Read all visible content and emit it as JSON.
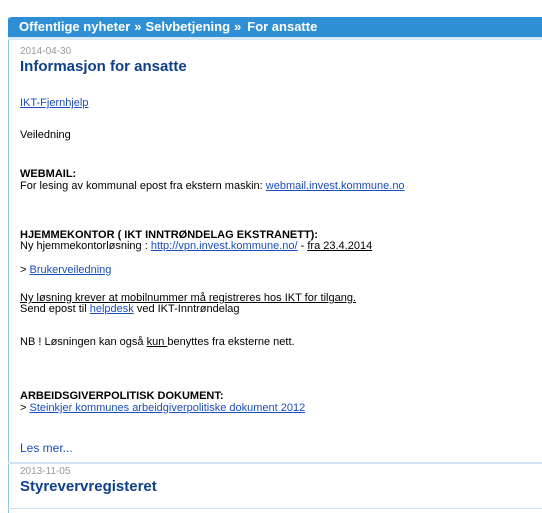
{
  "breadcrumb": {
    "items": [
      "Offentlige nyheter",
      "Selvbetjening",
      "For ansatte"
    ],
    "separator": "»"
  },
  "article1": {
    "date": "2014-04-30",
    "title": "Informasjon for ansatte",
    "ikt_link": "IKT-Fjernhjelp",
    "veiledning": "Veiledning",
    "webmail_heading": "WEBMAIL:",
    "webmail_text": "For lesing av kommunal epost fra ekstern maskin: ",
    "webmail_link": "webmail.invest.kommune.no",
    "hjemmekontor_heading": "HJEMMEKONTOR ( IKT INNTRØNDELAG EKSTRANETT):",
    "hjemmekontor_text": "Ny hjemmekontorløsning : ",
    "vpn_link": "http://vpn.invest.kommune.no/",
    "vpn_dash": " - ",
    "vpn_date": "fra 23.4.2014",
    "bruker_prefix": "> ",
    "brukerveiledning_link": "Brukerveiledning",
    "mobil_text": "Ny løsning krever at mobilnummer må registreres hos IKT for tilgang.",
    "send_prefix": "Send epost til ",
    "helpdesk_link": "helpdesk",
    "send_suffix": " ved IKT-Inntrøndelag",
    "nb_prefix": "NB ! Løsningen kan også ",
    "nb_kun": "kun ",
    "nb_suffix": "benyttes fra eksterne nett.",
    "arbeid_heading": "ARBEIDSGIVERPOLITISK DOKUMENT:",
    "arbeid_prefix": "> ",
    "arbeid_link": "Steinkjer kommunes arbeidgiverpolitiske dokument 2012",
    "les_mer": "Les mer..."
  },
  "article2": {
    "date": "2013-11-05",
    "title": "Styrevervregisteret"
  }
}
